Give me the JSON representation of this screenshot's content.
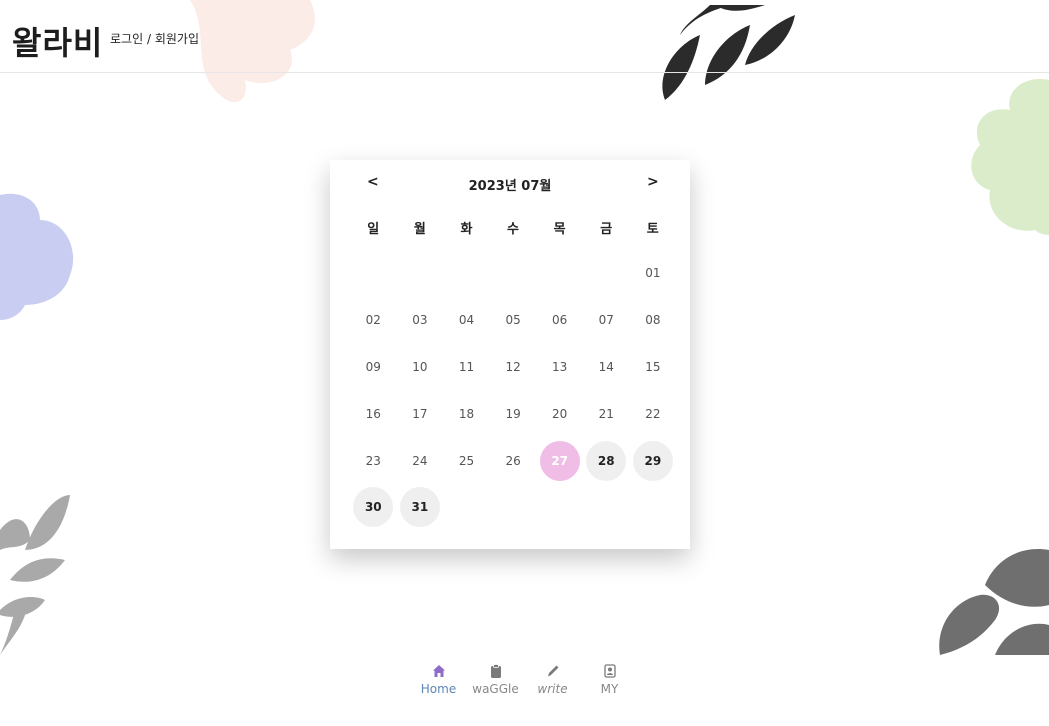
{
  "header": {
    "brand": "왈라비",
    "login": "로그인",
    "separator": "/",
    "signup": "회원가입"
  },
  "calendar": {
    "prev": "<",
    "next": ">",
    "title": "2023년 07월",
    "weekdays": [
      "일",
      "월",
      "화",
      "수",
      "목",
      "금",
      "토"
    ],
    "days": [
      "01",
      "02",
      "03",
      "04",
      "05",
      "06",
      "07",
      "08",
      "09",
      "10",
      "11",
      "12",
      "13",
      "14",
      "15",
      "16",
      "17",
      "18",
      "19",
      "20",
      "21",
      "22",
      "23",
      "24",
      "25",
      "26",
      "27",
      "28",
      "29",
      "30",
      "31"
    ],
    "today": "27",
    "colors": {
      "today": "#efbde6",
      "future": "#efefef"
    }
  },
  "bottom_nav": {
    "items": [
      {
        "label": "Home",
        "icon": "home-icon"
      },
      {
        "label": "waGGle",
        "icon": "clipboard-icon"
      },
      {
        "label": "write",
        "icon": "pencil-icon"
      },
      {
        "label": "MY",
        "icon": "profile-icon"
      }
    ],
    "active_color": "#5d86b8"
  }
}
